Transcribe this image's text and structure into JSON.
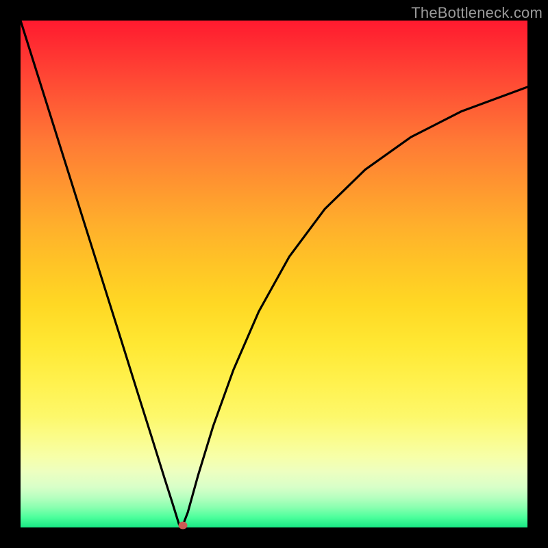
{
  "watermark": "TheBottleneck.com",
  "chart_data": {
    "type": "line",
    "title": "",
    "xlabel": "",
    "ylabel": "",
    "xlim": [
      0,
      100
    ],
    "ylim": [
      0,
      100
    ],
    "x": [
      0,
      4,
      8,
      12,
      16,
      20,
      23,
      26,
      28.5,
      30,
      31.3,
      32,
      33,
      35,
      38,
      42,
      47,
      53,
      60,
      68,
      77,
      87,
      100
    ],
    "values": [
      100,
      87.3,
      74.6,
      61.9,
      49.2,
      36.5,
      26.9,
      17.4,
      9.4,
      4.7,
      0.5,
      0.4,
      3.0,
      10.2,
      20.0,
      31.1,
      42.6,
      53.4,
      62.8,
      70.6,
      77.0,
      82.1,
      86.9
    ],
    "grid": false,
    "annotations": [
      {
        "type": "marker",
        "x": 32,
        "y": 0.4,
        "color": "#cd5a54"
      }
    ],
    "colors": {
      "gradient_top": "#ff1a2f",
      "gradient_bottom": "#18e884",
      "curve": "#000000",
      "background": "#000000"
    }
  }
}
